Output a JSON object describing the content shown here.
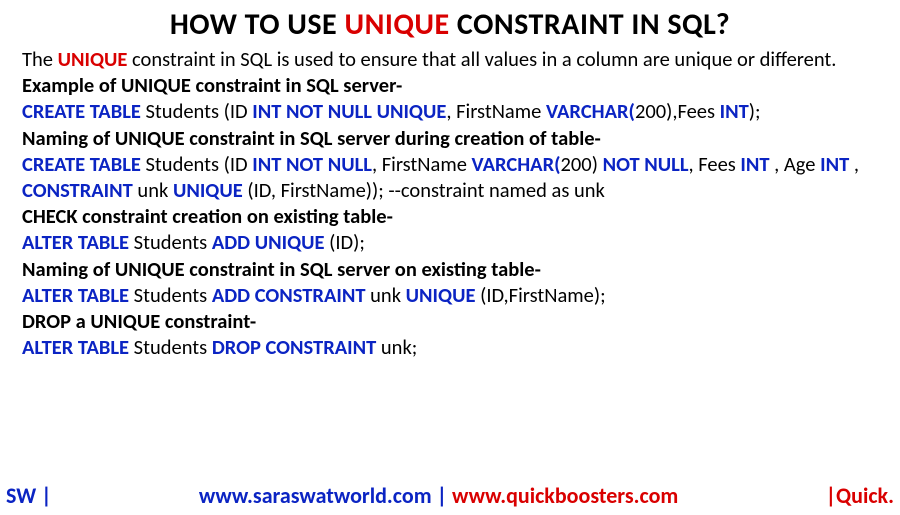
{
  "title": {
    "pre": "HOW TO USE ",
    "mid": "UNIQUE",
    "post": " CONSTRAINT IN SQL?"
  },
  "intro": {
    "p0": "The ",
    "p1": "UNIQUE",
    "p2": " constraint in SQL is used to ensure that all values in a column are unique or different."
  },
  "h1": "Example of UNIQUE constraint in SQL server-",
  "ex1": {
    "s0": "CREATE TABLE",
    "s1": " Students (ID ",
    "s2": "INT NOT NULL UNIQUE",
    "s3": ", FirstName ",
    "s4": "VARCHAR(",
    "s5": "200),Fees ",
    "s6": "INT",
    "s7": ");"
  },
  "h2": "Naming of UNIQUE constraint in SQL server during creation of table-",
  "ex2a": {
    "s0": "CREATE TABLE",
    "s1": " Students (ID ",
    "s2": "INT NOT NULL",
    "s3": ", FirstName ",
    "s4": "VARCHAR(",
    "s5": "200) ",
    "s6": "NOT NULL",
    "s7": ", Fees ",
    "s8": "INT",
    "s9": " , Age ",
    "s10": "INT",
    "s11": " ,"
  },
  "ex2b": {
    "s0": "CONSTRAINT",
    "s1": " unk ",
    "s2": "UNIQUE",
    "s3": " (ID, FirstName));  --constraint named as unk"
  },
  "h3": "CHECK constraint creation on existing table-",
  "ex3": {
    "s0": "ALTER TABLE",
    "s1": " Students ",
    "s2": "ADD UNIQUE",
    "s3": " (ID);"
  },
  "h4": "Naming of UNIQUE constraint in SQL server on existing table-",
  "ex4": {
    "s0": "ALTER TABLE",
    "s1": " Students ",
    "s2": "ADD CONSTRAINT",
    "s3": " unk ",
    "s4": "UNIQUE",
    "s5": " (ID,FirstName);"
  },
  "h5": "DROP a UNIQUE constraint-",
  "ex5": {
    "s0": "ALTER TABLE",
    "s1": " Students ",
    "s2": "DROP CONSTRAINT",
    "s3": " unk;"
  },
  "footer": {
    "left": "SW |",
    "mid1": "www.saraswatworld.com",
    "midSep": " | ",
    "mid2": "www.quickboosters.com",
    "right": "|Quick."
  }
}
